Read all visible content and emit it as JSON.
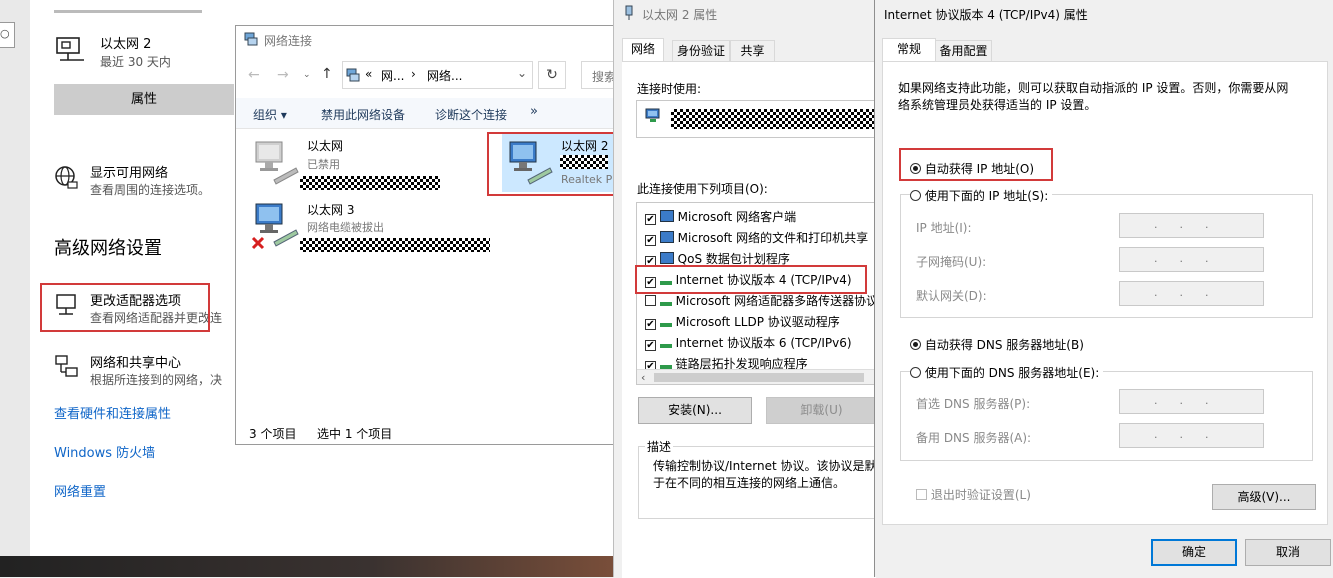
{
  "settings": {
    "ethernet": {
      "name": "以太网 2",
      "sub": "最近 30 天内"
    },
    "properties_button": "属性",
    "show_networks": {
      "title": "显示可用网络",
      "sub": "查看周围的连接选项。"
    },
    "advanced_heading": "高级网络设置",
    "change_adapter": {
      "title": "更改适配器选项",
      "sub": "查看网络适配器并更改连"
    },
    "sharing_center": {
      "title": "网络和共享中心",
      "sub": "根据所连接到的网络，决"
    },
    "links": [
      "查看硬件和连接属性",
      "Windows 防火墙",
      "网络重置"
    ]
  },
  "netconn": {
    "title": "网络连接",
    "address": {
      "prefix": "«",
      "seg1": "网...",
      "sep": "›",
      "seg2": "网络..."
    },
    "search_placeholder": "搜索",
    "toolbar": {
      "organize": "组织 ▾",
      "disable": "禁用此网络设备",
      "diagnose": "诊断这个连接",
      "more": "»"
    },
    "items": [
      {
        "name": "以太网",
        "status": "已禁用"
      },
      {
        "name": "以太网 2",
        "status": "",
        "driver": "Realtek P"
      },
      {
        "name": "以太网 3",
        "status": "网络电缆被拔出"
      }
    ],
    "status_bar": {
      "count": "3 个项目",
      "selected": "选中 1 个项目"
    }
  },
  "eth2props": {
    "title": "以太网 2 属性",
    "tabs": [
      "网络",
      "身份验证",
      "共享"
    ],
    "connect_using": "连接时使用:",
    "items_label": "此连接使用下列项目(O):",
    "items": [
      {
        "label": "Microsoft 网络客户端",
        "checked": true
      },
      {
        "label": "Microsoft 网络的文件和打印机共享",
        "checked": true
      },
      {
        "label": "QoS 数据包计划程序",
        "checked": true
      },
      {
        "label": "Internet 协议版本 4 (TCP/IPv4)",
        "checked": true
      },
      {
        "label": "Microsoft 网络适配器多路传送器协议",
        "checked": false
      },
      {
        "label": "Microsoft LLDP 协议驱动程序",
        "checked": true
      },
      {
        "label": "Internet 协议版本 6 (TCP/IPv6)",
        "checked": true
      },
      {
        "label": "链路层拓扑发现响应程序",
        "checked": true
      }
    ],
    "install_button": "安装(N)...",
    "uninstall_button": "卸载(U)",
    "description_label": "描述",
    "description_text": "传输控制协议/Internet 协议。该协议是默认的广域网络协议，用于在不同的相互连接的网络上通信。",
    "description_line1": "传输控制协议/Internet 协议。该协议是默",
    "description_line2": "于在不同的相互连接的网络上通信。"
  },
  "ipv4": {
    "title": "Internet 协议版本 4 (TCP/IPv4) 属性",
    "tabs": [
      "常规",
      "备用配置"
    ],
    "intro_line1": "如果网络支持此功能，则可以获取自动指派的 IP 设置。否则，你需要从网",
    "intro_line2": "络系统管理员处获得适当的 IP 设置。",
    "auto_ip": "自动获得 IP 地址(O)",
    "manual_ip": "使用下面的 IP 地址(S):",
    "ip_label": "IP 地址(I):",
    "mask_label": "子网掩码(U):",
    "gateway_label": "默认网关(D):",
    "auto_dns": "自动获得 DNS 服务器地址(B)",
    "manual_dns": "使用下面的 DNS 服务器地址(E):",
    "dns1_label": "首选 DNS 服务器(P):",
    "dns2_label": "备用 DNS 服务器(A):",
    "validate": "退出时验证设置(L)",
    "advanced_button": "高级(V)...",
    "ok_button": "确定",
    "cancel_button": "取消",
    "ip_dots": "...",
    "selected_ip_mode": "auto",
    "selected_dns_mode": "auto"
  }
}
